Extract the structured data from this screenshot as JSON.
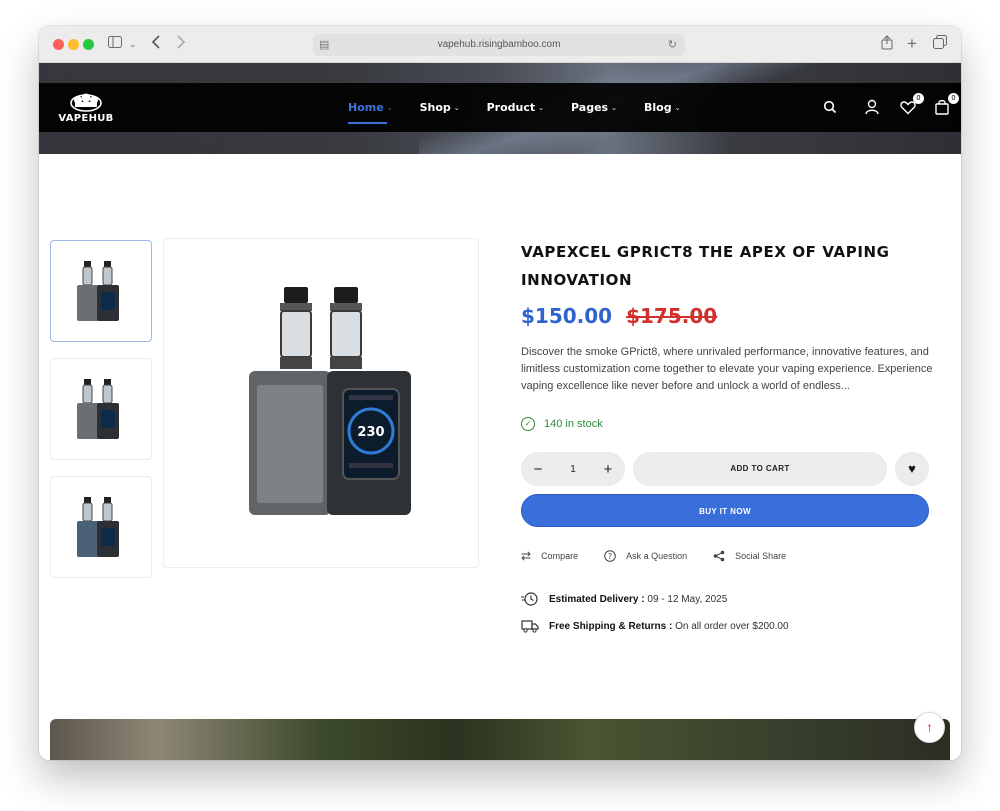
{
  "browser": {
    "url": "vapehub.risingbamboo.com"
  },
  "header": {
    "logo_text": "VAPEHUB",
    "nav": [
      {
        "label": "Home",
        "active": true
      },
      {
        "label": "Shop",
        "active": false
      },
      {
        "label": "Product",
        "active": false
      },
      {
        "label": "Pages",
        "active": false
      },
      {
        "label": "Blog",
        "active": false
      }
    ],
    "wishlist_count": "0",
    "cart_count": "0"
  },
  "product": {
    "title": "VAPEXCEL GPRICT8 THE APEX OF VAPING INNOVATION",
    "price": "$150.00",
    "old_price": "$175.00",
    "description": "Discover the smoke GPrict8, where unrivaled performance, innovative features, and limitless customization come together to elevate your vaping experience. Experience vaping excellence like never before and unlock a world of endless...",
    "stock": "140 in stock",
    "quantity": "1",
    "add_to_cart": "ADD TO CART",
    "buy_now": "BUY IT NOW",
    "actions": {
      "compare": "Compare",
      "ask": "Ask a Question",
      "share": "Social Share"
    },
    "delivery_label": "Estimated Delivery :",
    "delivery_value": "09 - 12 May, 2025",
    "shipping_label": "Free Shipping & Returns :",
    "shipping_value": "On all order over $200.00"
  },
  "colors": {
    "accent": "#3a6fdb",
    "sale": "#d0312d",
    "stock": "#2e8b3a"
  }
}
